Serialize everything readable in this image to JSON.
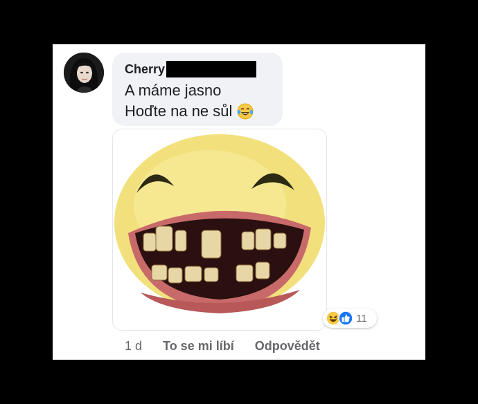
{
  "comment": {
    "author": "Cherry",
    "lines": [
      "A máme jasno",
      "Hoďte na ne sůl"
    ],
    "inline_emoji": "laughing-tears-emoji"
  },
  "attachment": {
    "image": "smiley-face-with-bad-teeth"
  },
  "reactions": {
    "icons": [
      "haha-reaction-icon",
      "like-reaction-icon"
    ],
    "count": "11"
  },
  "actions": {
    "time": "1 d",
    "like_label": "To se mi líbí",
    "reply_label": "Odpovědět"
  },
  "colors": {
    "bubble": "#f0f2f5",
    "meta_text": "#65676b",
    "like_blue": "#1877f2",
    "face_yellow": "#f4e27a"
  }
}
